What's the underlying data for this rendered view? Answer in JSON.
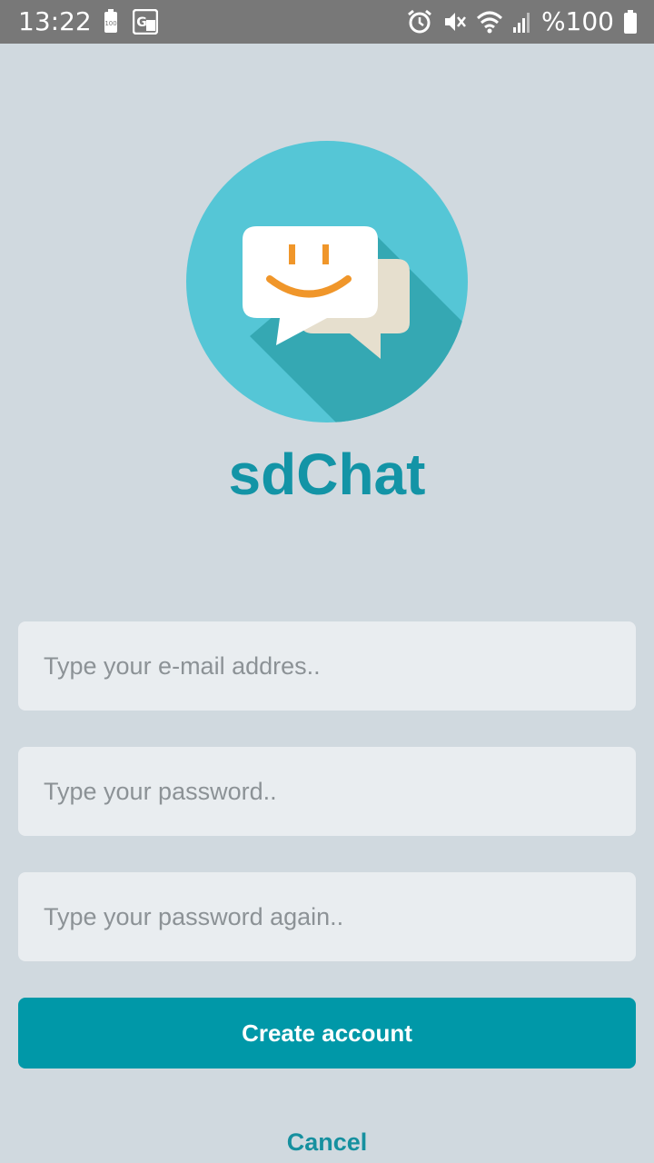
{
  "status_bar": {
    "time": "13:22",
    "battery_text": "%100",
    "icons_left": [
      "battery-saver-icon",
      "google-translate-icon"
    ],
    "icons_right": [
      "alarm-icon",
      "vibrate-mute-icon",
      "wifi-icon",
      "signal-icon",
      "battery-icon"
    ]
  },
  "app": {
    "title": "sdChat"
  },
  "form": {
    "email_placeholder": "Type your e-mail addres..",
    "password_placeholder": "Type your password..",
    "password_again_placeholder": "Type your password again..",
    "create_label": "Create account",
    "cancel_label": "Cancel"
  },
  "colors": {
    "background": "#d0d9df",
    "accent": "#0098a8",
    "logo_circle": "#55c6d6",
    "logo_shadow": "#35a8b3",
    "smile": "#f0962a"
  }
}
